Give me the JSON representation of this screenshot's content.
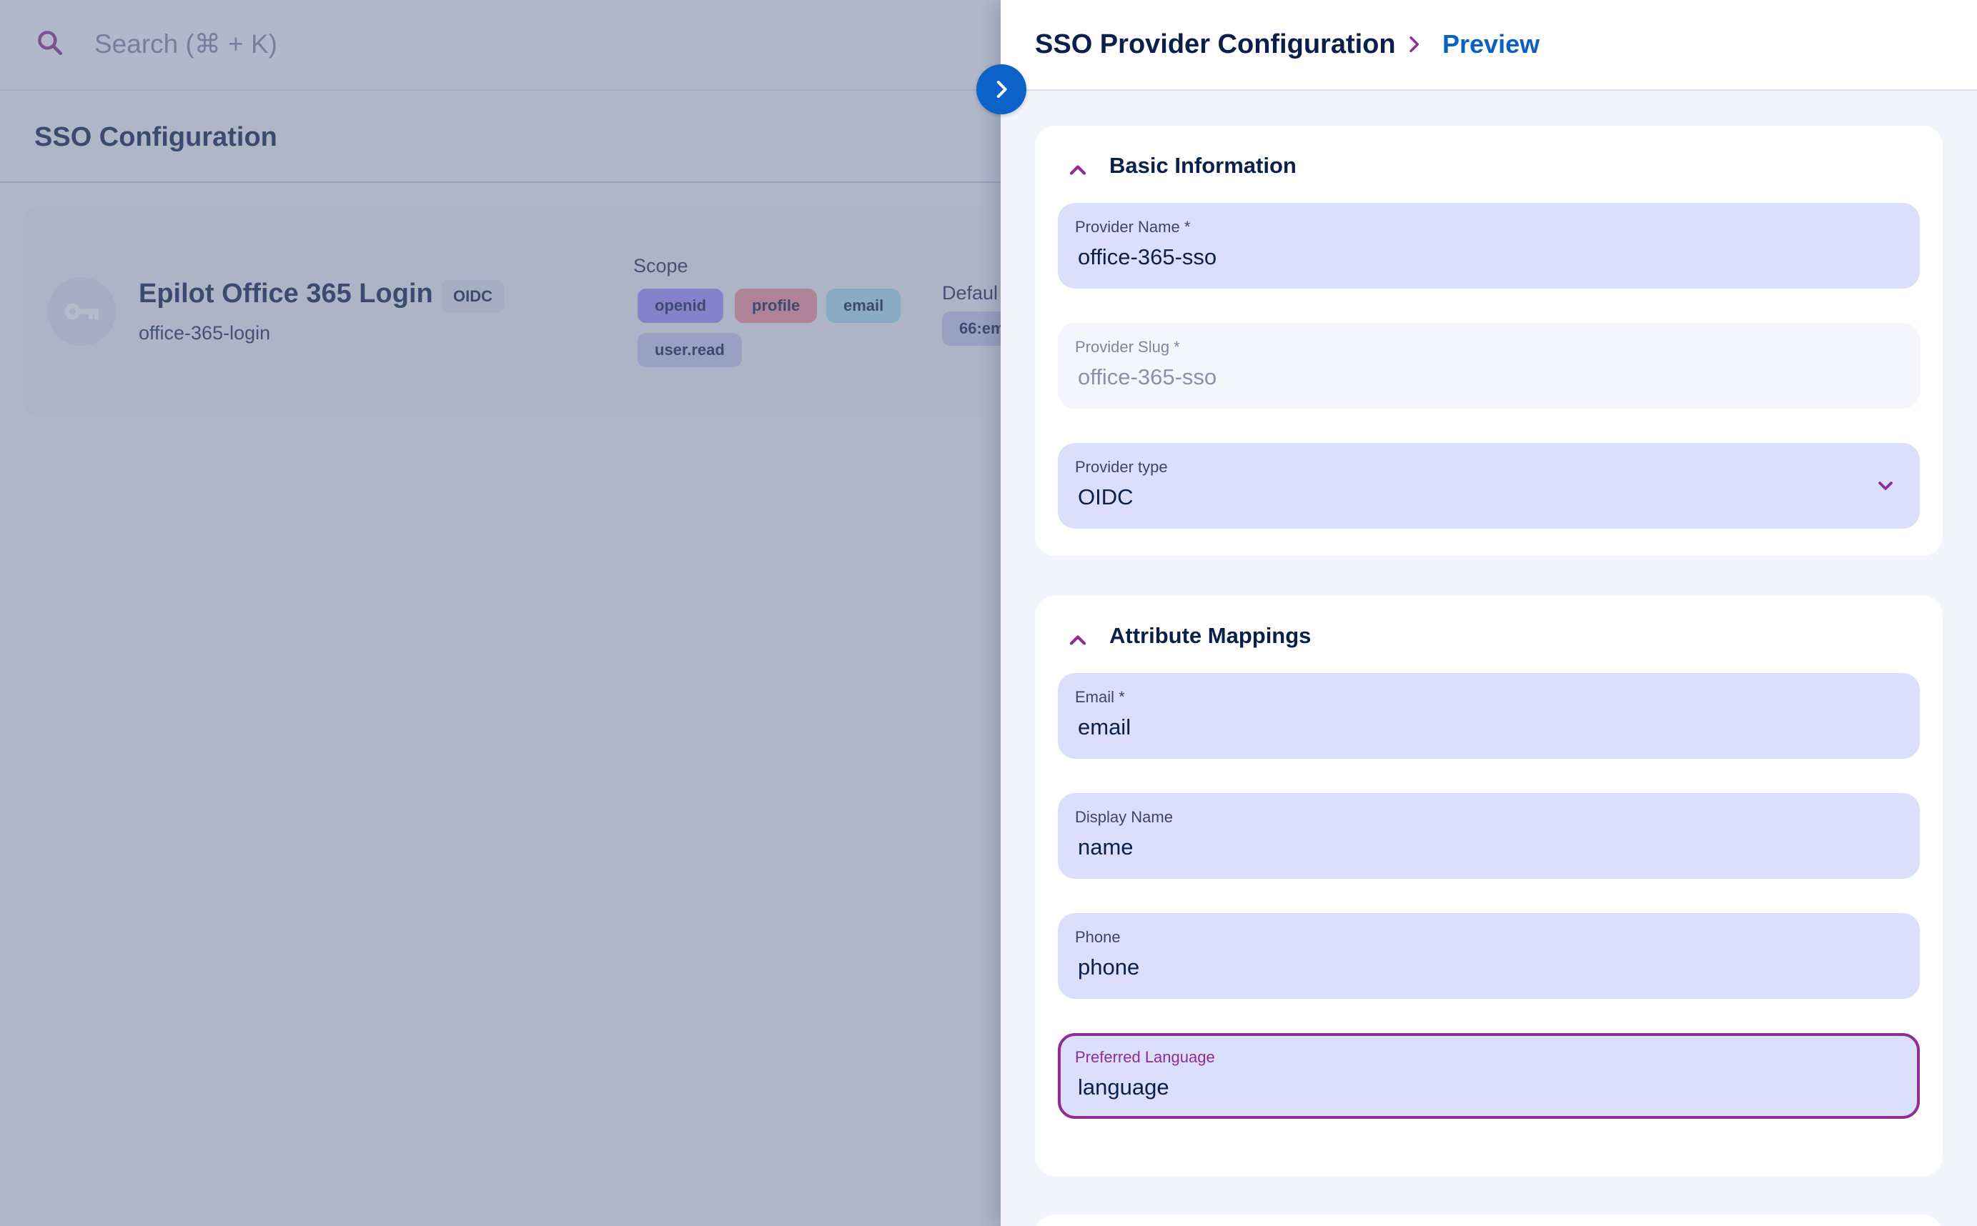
{
  "search": {
    "placeholder": "Search (⌘ + K)",
    "icon": "search-icon"
  },
  "page": {
    "title": "SSO Configuration"
  },
  "card": {
    "title": "Epilot Office 365 Login",
    "type_badge": "OIDC",
    "subtitle": "office-365-login",
    "scope_label": "Scope",
    "scopes": [
      {
        "label": "openid",
        "color": "#9c8cff"
      },
      {
        "label": "profile",
        "color": "#f28c9a"
      },
      {
        "label": "email",
        "color": "#a6dff0"
      },
      {
        "label": "user.read",
        "color": "#c5cbef"
      }
    ],
    "default_label": "Defaul",
    "default_value": "66:em",
    "avatar_icon": "key-icon"
  },
  "drawer": {
    "title": "SSO Provider Configuration",
    "breadcrumb_current": "Preview",
    "collapse_icon": "chevron-right-icon",
    "sections": {
      "basic": {
        "title": "Basic Information",
        "fields": {
          "provider_name": {
            "label": "Provider Name *",
            "value": "office-365-sso"
          },
          "provider_slug": {
            "label": "Provider Slug *",
            "value": "office-365-sso",
            "disabled": true
          },
          "provider_type": {
            "label": "Provider type",
            "value": "OIDC"
          }
        }
      },
      "attributes": {
        "title": "Attribute Mappings",
        "fields": {
          "email": {
            "label": "Email *",
            "value": "email"
          },
          "display_name": {
            "label": "Display Name",
            "value": "name"
          },
          "phone": {
            "label": "Phone",
            "value": "phone"
          },
          "preferred_language": {
            "label": "Preferred Language",
            "value": "language",
            "focused": true
          }
        }
      }
    }
  },
  "colors": {
    "accent": "#8e2d93",
    "primary": "#0d62c9",
    "text": "#0b1f4b",
    "field_bg": "#dcdffb"
  }
}
